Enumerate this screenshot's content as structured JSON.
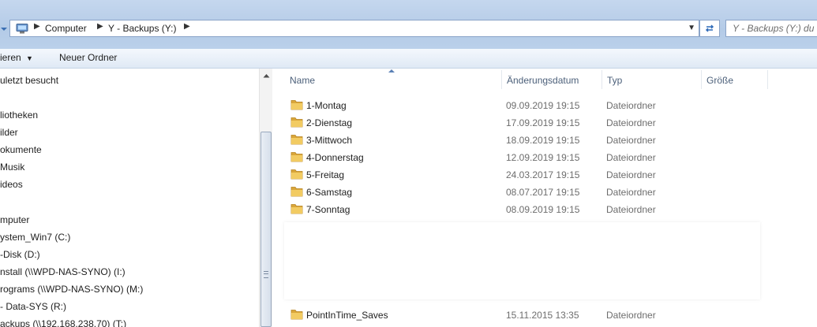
{
  "address_bar": {
    "crumbs": [
      "Computer",
      "Y - Backups (Y:)"
    ],
    "separator_glyph": "▶",
    "dropdown_glyph": "▼"
  },
  "search": {
    "placeholder": "Y - Backups (Y:) du"
  },
  "toolbar": {
    "organize_label": "ieren",
    "new_folder_label": "Neuer Ordner"
  },
  "nav_pane": {
    "items": [
      "uletzt besucht",
      "liotheken",
      "ilder",
      "okumente",
      "Musik",
      "ideos",
      "mputer",
      "ystem_Win7 (C:)",
      "-Disk (D:)",
      "nstall (\\\\WPD-NAS-SYNO) (I:)",
      "rograms (\\\\WPD-NAS-SYNO) (M:)",
      "- Data-SYS (R:)",
      "ackups (\\\\192.168.238.70) (T:)"
    ]
  },
  "file_list": {
    "columns": {
      "name": "Name",
      "modified": "Änderungsdatum",
      "type": "Typ",
      "size": "Größe"
    },
    "rows": [
      {
        "name": "1-Montag",
        "modified": "09.09.2019 19:15",
        "type": "Dateiordner"
      },
      {
        "name": "2-Dienstag",
        "modified": "17.09.2019 19:15",
        "type": "Dateiordner"
      },
      {
        "name": "3-Mittwoch",
        "modified": "18.09.2019 19:15",
        "type": "Dateiordner"
      },
      {
        "name": "4-Donnerstag",
        "modified": "12.09.2019 19:15",
        "type": "Dateiordner"
      },
      {
        "name": "5-Freitag",
        "modified": "24.03.2017 19:15",
        "type": "Dateiordner"
      },
      {
        "name": "6-Samstag",
        "modified": "08.07.2017 19:15",
        "type": "Dateiordner"
      },
      {
        "name": "7-Sonntag",
        "modified": "08.09.2019 19:15",
        "type": "Dateiordner"
      },
      {
        "name": "PointInTime_Saves",
        "modified": "15.11.2015 13:35",
        "type": "Dateiordner"
      }
    ]
  },
  "colors": {
    "titlebar": "#b9cfe9",
    "folder": "#e8b94a",
    "header_text": "#4c607a"
  },
  "icons": [
    "computer-icon",
    "folder-icon",
    "refresh-icon",
    "chevron-down-icon"
  ]
}
